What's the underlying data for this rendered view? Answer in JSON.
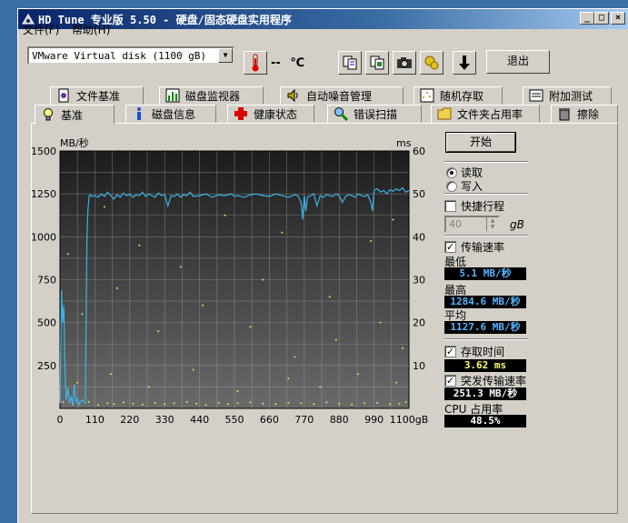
{
  "window": {
    "title": "HD Tune 专业版 5.50 - 硬盘/固态硬盘实用程序"
  },
  "menu": {
    "file": "文件(F)",
    "help": "帮助(H)"
  },
  "toolbar": {
    "disk": "VMware  Virtual disk (1100 gB)",
    "temperature": "--",
    "temp_unit": "℃",
    "exit_label": "退出"
  },
  "tabs_top": [
    {
      "label": "文件基准"
    },
    {
      "label": "磁盘监视器"
    },
    {
      "label": "自动噪音管理"
    },
    {
      "label": "随机存取"
    },
    {
      "label": "附加测试"
    }
  ],
  "tabs_bottom": [
    {
      "label": "基准",
      "active": true
    },
    {
      "label": "磁盘信息"
    },
    {
      "label": "健康状态"
    },
    {
      "label": "错误扫描"
    },
    {
      "label": "文件夹占用率"
    },
    {
      "label": "擦除"
    }
  ],
  "controls": {
    "start_label": "开始",
    "read_label": "读取",
    "write_label": "写入",
    "short_stroke_label": "快捷行程",
    "short_stroke_value": "40",
    "short_stroke_unit": "gB",
    "transfer_rate_label": "传输速率",
    "min_label": "最低",
    "min_value": "5.1 MB/秒",
    "max_label": "最高",
    "max_value": "1284.6 MB/秒",
    "avg_label": "平均",
    "avg_value": "1127.6 MB/秒",
    "access_time_label": "存取时间",
    "access_time_value": "3.62 ms",
    "burst_label": "突发传输速率",
    "burst_value": "251.3 MB/秒",
    "cpu_label": "CPU 占用率",
    "cpu_value": "48.5%"
  },
  "chart_data": {
    "type": "line",
    "ylabel": "MB/秒",
    "y2label": "ms",
    "xunit": "gB",
    "x_ticks": [
      "0",
      "110",
      "220",
      "330",
      "440",
      "550",
      "660",
      "770",
      "880",
      "990",
      "1100gB"
    ],
    "y_ticks": [
      "250",
      "500",
      "750",
      "1000",
      "1250",
      "1500"
    ],
    "y2_ticks": [
      "10",
      "20",
      "30",
      "40",
      "50",
      "60"
    ],
    "xlim": [
      0,
      1100
    ],
    "ylim": [
      0,
      1500
    ],
    "y2lim": [
      0,
      60
    ],
    "grid": true,
    "colors": {
      "transfer": "#3cb4e6",
      "access": "#e6e64a",
      "background": "#2b2b2b"
    },
    "series": [
      {
        "name": "传输速率",
        "x": [
          0,
          5,
          8,
          12,
          16,
          20,
          25,
          30,
          35,
          40,
          45,
          50,
          55,
          60,
          65,
          70,
          75,
          80,
          85,
          88,
          92,
          95,
          100,
          110,
          120,
          130,
          140,
          150,
          160,
          170,
          180,
          190,
          200,
          210,
          220,
          230,
          240,
          250,
          260,
          270,
          280,
          290,
          300,
          310,
          320,
          330,
          340,
          350,
          360,
          370,
          380,
          390,
          400,
          410,
          420,
          440,
          460,
          480,
          500,
          520,
          540,
          550,
          560,
          580,
          600,
          620,
          640,
          660,
          680,
          700,
          720,
          740,
          750,
          760,
          765,
          770,
          775,
          780,
          790,
          800,
          810,
          820,
          830,
          840,
          850,
          860,
          870,
          880,
          890,
          900,
          910,
          920,
          930,
          940,
          950,
          960,
          970,
          980,
          985,
          990,
          1000,
          1010,
          1020,
          1030,
          1040,
          1050,
          1060,
          1070,
          1080,
          1090,
          1100
        ],
        "y": [
          30,
          690,
          500,
          600,
          200,
          50,
          120,
          30,
          70,
          20,
          140,
          40,
          60,
          20,
          40,
          50,
          40,
          30,
          1000,
          1150,
          1240,
          1245,
          1235,
          1240,
          1230,
          1250,
          1235,
          1260,
          1240,
          1220,
          1245,
          1230,
          1255,
          1240,
          1250,
          1230,
          1245,
          1240,
          1260,
          1235,
          1250,
          1240,
          1230,
          1255,
          1240,
          1245,
          1180,
          1240,
          1235,
          1250,
          1230,
          1245,
          1240,
          1260,
          1235,
          1240,
          1250,
          1230,
          1245,
          1240,
          1250,
          1235,
          1240,
          1230,
          1245,
          1250,
          1240,
          1235,
          1250,
          1240,
          1230,
          1245,
          1240,
          1200,
          1100,
          1240,
          1150,
          1230,
          1240,
          1250,
          1180,
          1240,
          1230,
          1245,
          1240,
          1235,
          1250,
          1240,
          1200,
          1235,
          1245,
          1240,
          1230,
          1250,
          1240,
          1235,
          1245,
          1200,
          1150,
          1270,
          1280,
          1260,
          1270,
          1250,
          1275,
          1265,
          1280,
          1270,
          1285,
          1260,
          1270
        ]
      },
      {
        "name": "存取时间",
        "x": [
          10,
          40,
          60,
          90,
          120,
          150,
          170,
          200,
          230,
          260,
          300,
          330,
          360,
          400,
          430,
          460,
          500,
          530,
          560,
          600,
          640,
          680,
          720,
          760,
          800,
          840,
          880,
          920,
          960,
          1000,
          1040,
          1070,
          1090,
          25,
          140,
          250,
          380,
          520,
          640,
          700,
          850,
          980,
          1050,
          70,
          180,
          310,
          450,
          600,
          740,
          870,
          1010,
          1080,
          55,
          160,
          280,
          420,
          560,
          720,
          820,
          940,
          1060
        ],
        "y": [
          1.5,
          1,
          1.2,
          1.5,
          0.8,
          1.2,
          1,
          1.4,
          1.1,
          0.9,
          1.3,
          1,
          1.2,
          1.5,
          1.1,
          0.8,
          1.3,
          1,
          1.2,
          1.4,
          1.1,
          1,
          1.3,
          1.2,
          1,
          1.4,
          1.1,
          0.9,
          1.2,
          1.3,
          1,
          1.1,
          1.5,
          36,
          47,
          38,
          33,
          45,
          30,
          41,
          26,
          39,
          44,
          22,
          28,
          18,
          24,
          19,
          12,
          16,
          20,
          14,
          6,
          8,
          5,
          9,
          4,
          7,
          5,
          8,
          6
        ]
      }
    ]
  }
}
